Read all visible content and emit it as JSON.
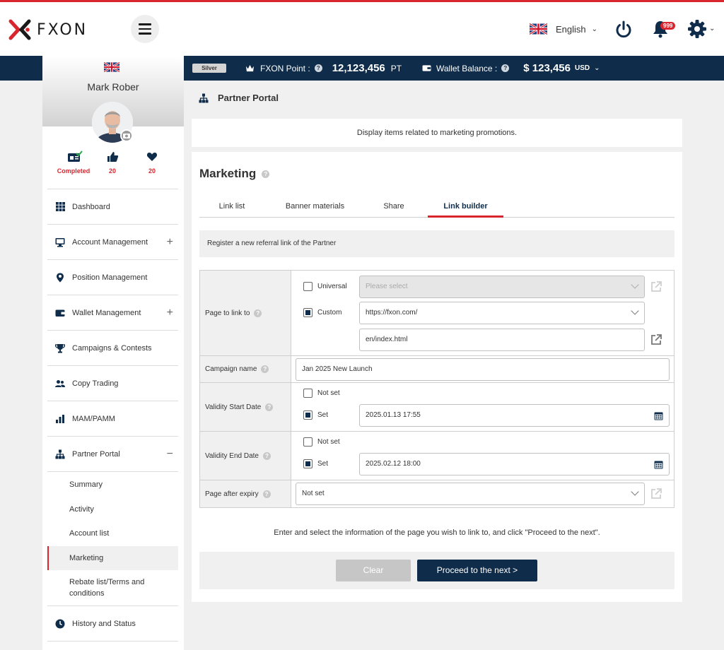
{
  "brand": {
    "name": "FXON",
    "accent": "#d9262e",
    "navy": "#0f2d4a"
  },
  "header": {
    "language": "English",
    "notifications": "999"
  },
  "statusbar": {
    "rank": "Silver",
    "point_label": "FXON Point :",
    "point_value": "12,123,456",
    "point_unit": "PT",
    "wallet_label": "Wallet Balance :",
    "wallet_value": "$ 123,456",
    "wallet_unit": "USD"
  },
  "profile": {
    "name": "Mark Rober",
    "stats": [
      {
        "icon": "id-card-check-icon",
        "value": "Completed"
      },
      {
        "icon": "thumbs-up-icon",
        "value": "20"
      },
      {
        "icon": "heart-icon",
        "value": "20"
      }
    ]
  },
  "sidebar": {
    "items": [
      {
        "label": "Dashboard",
        "icon": "grid-icon"
      },
      {
        "label": "Account Management",
        "icon": "monitor-icon",
        "expand": "+"
      },
      {
        "label": "Position Management",
        "icon": "pin-icon"
      },
      {
        "label": "Wallet Management",
        "icon": "wallet-icon",
        "expand": "+"
      },
      {
        "label": "Campaigns & Contests",
        "icon": "trophy-icon"
      },
      {
        "label": "Copy Trading",
        "icon": "users-icon"
      },
      {
        "label": "MAM/PAMM",
        "icon": "bar-chart-icon"
      },
      {
        "label": "Partner Portal",
        "icon": "hierarchy-icon",
        "expand": "−"
      }
    ],
    "sub_items": [
      "Summary",
      "Activity",
      "Account list",
      "Marketing",
      "Rebate list/Terms and conditions"
    ],
    "last_item": {
      "label": "History and Status",
      "icon": "clock-icon"
    }
  },
  "main": {
    "breadcrumb": "Partner Portal",
    "intro": "Display items related to marketing promotions.",
    "title": "Marketing",
    "tabs": [
      "Link list",
      "Banner materials",
      "Share",
      "Link builder"
    ],
    "notice": "Register a new referral link of the Partner",
    "form": {
      "page_link_label": "Page to link to",
      "universal_label": "Universal",
      "universal_placeholder": "Please select",
      "custom_label": "Custom",
      "custom_domain": "https://fxon.com/",
      "custom_path": "en/index.html",
      "campaign_label": "Campaign name",
      "campaign_value": "Jan 2025 New Launch",
      "start_label": "Validity Start Date",
      "start_notset": "Not set",
      "start_set": "Set",
      "start_value": "2025.01.13 17:55",
      "end_label": "Validity End Date",
      "end_notset": "Not set",
      "end_set": "Set",
      "end_value": "2025.02.12 18:00",
      "expiry_label": "Page after expiry",
      "expiry_value": "Not set"
    },
    "hint": "Enter and select the information of the page you wish to link to, and click \"Proceed to the next\".",
    "clear_label": "Clear",
    "next_label": "Proceed to the next >"
  }
}
